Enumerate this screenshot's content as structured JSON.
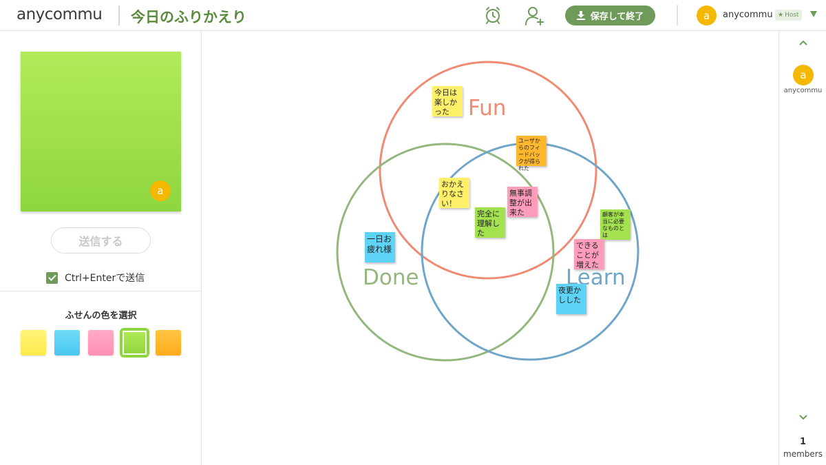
{
  "header": {
    "logo": "anycommu",
    "title": "今日のふりかえり",
    "save_label": "保存して終了",
    "user": {
      "avatar_letter": "a",
      "name": "anycommu",
      "badge": "Host"
    }
  },
  "left_panel": {
    "avatar_letter": "a",
    "send_label": "送信する",
    "ctrl_enter_label": "Ctrl+Enterで送信",
    "ctrl_enter_checked": true,
    "color_title": "ふせんの色を選択",
    "colors": [
      {
        "name": "yellow",
        "hex": "#fff06a"
      },
      {
        "name": "blue",
        "hex": "#5fd3f6"
      },
      {
        "name": "pink",
        "hex": "#ff9dbb"
      },
      {
        "name": "green",
        "hex": "#a3e14e",
        "selected": true
      },
      {
        "name": "orange",
        "hex": "#ffb82d"
      }
    ],
    "preview_color": "#a3e14e"
  },
  "venn": {
    "circles": [
      {
        "label": "Fun",
        "color": "#f08a72"
      },
      {
        "label": "Done",
        "color": "#93b77c"
      },
      {
        "label": "Learn",
        "color": "#6fa5c8"
      }
    ]
  },
  "stickies": [
    {
      "text": "今日は楽しかった",
      "color": "#fff06a"
    },
    {
      "text": "ユーザからのフィードバックが得られた",
      "color": "#ffb82d"
    },
    {
      "text": "おかえりなさい！",
      "color": "#fff06a"
    },
    {
      "text": "無事調整が出来た",
      "color": "#ff9dbb"
    },
    {
      "text": "完全に理解した",
      "color": "#a3e14e"
    },
    {
      "text": "一日お疲れ様",
      "color": "#5fd3f6"
    },
    {
      "text": "顧客が本当に必要なものとは",
      "color": "#a3e14e"
    },
    {
      "text": "できることが増えた",
      "color": "#ff9dbb"
    },
    {
      "text": "夜更かしした",
      "color": "#5fd3f6"
    }
  ],
  "right_panel": {
    "members": [
      {
        "avatar_letter": "a",
        "name": "anycommu"
      }
    ],
    "count": "1",
    "count_label": "members"
  }
}
